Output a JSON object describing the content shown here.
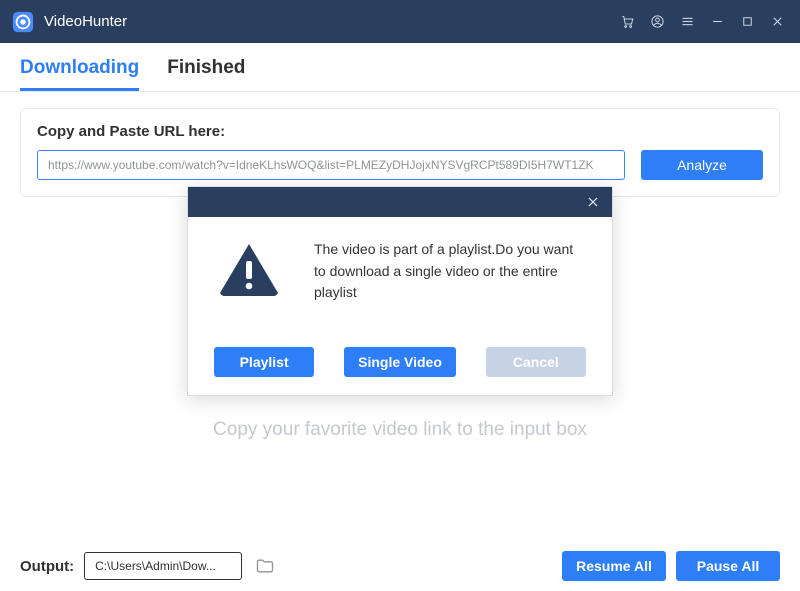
{
  "titlebar": {
    "app_name": "VideoHunter"
  },
  "tabs": {
    "downloading": "Downloading",
    "finished": "Finished"
  },
  "url_card": {
    "label": "Copy and Paste URL here:",
    "input_value": "https://www.youtube.com/watch?v=IdneKLhsWOQ&list=PLMEZyDHJojxNYSVgRCPt589DI5H7WT1ZK",
    "analyze_label": "Analyze"
  },
  "hint_text": "Copy your favorite video link to the input box",
  "modal": {
    "message": "The video is part of a playlist.Do you want to download a single video or the entire playlist",
    "playlist_label": "Playlist",
    "single_label": "Single Video",
    "cancel_label": "Cancel"
  },
  "footer": {
    "output_label": "Output:",
    "output_path": "C:\\Users\\Admin\\Dow...",
    "resume_label": "Resume All",
    "pause_label": "Pause All"
  }
}
